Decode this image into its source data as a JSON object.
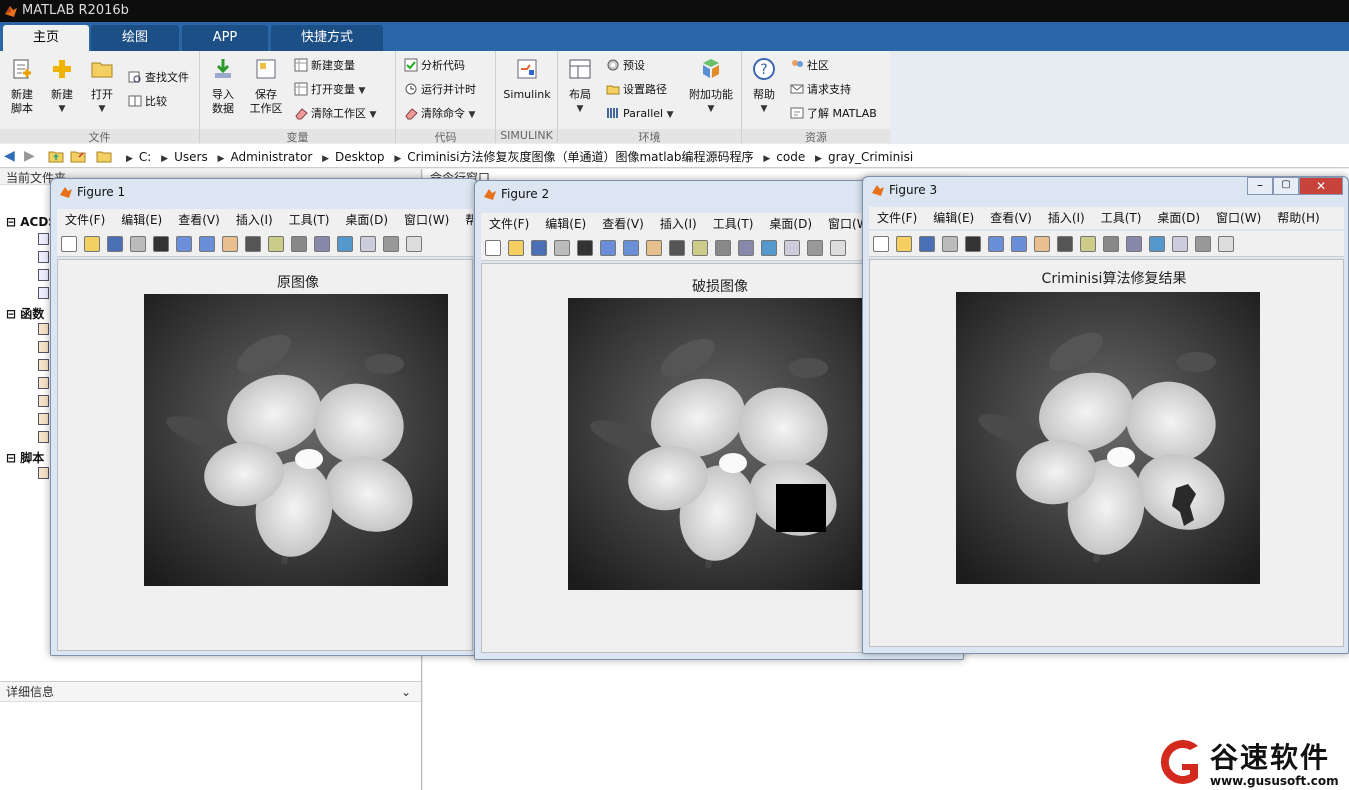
{
  "app": {
    "title": "MATLAB R2016b"
  },
  "ribbon": {
    "tabs": [
      "主页",
      "绘图",
      "APP",
      "快捷方式"
    ],
    "groups": {
      "file": {
        "label": "文件",
        "new_script": "新建\n脚本",
        "new": "新建",
        "open": "打开",
        "find_files": "查找文件",
        "compare": "比较"
      },
      "variable": {
        "label": "变量",
        "import": "导入\n数据",
        "save_ws": "保存\n工作区",
        "new_var": "新建变量",
        "open_var": "打开变量",
        "clear_ws": "清除工作区"
      },
      "code": {
        "label": "代码",
        "analyze": "分析代码",
        "run_time": "运行并计时",
        "clear_cmd": "清除命令"
      },
      "simulink": {
        "label": "SIMULINK",
        "simulink": "Simulink"
      },
      "env": {
        "label": "环境",
        "layout": "布局",
        "prefs": "预设",
        "set_path": "设置路径",
        "parallel": "Parallel",
        "addons": "附加功能"
      },
      "resources": {
        "label": "资源",
        "help": "帮助",
        "community": "社区",
        "support": "请求支持",
        "learn": "了解 MATLAB"
      }
    }
  },
  "address": {
    "crumbs": [
      "C:",
      "Users",
      "Administrator",
      "Desktop",
      "Criminisi方法修复灰度图像（单通道）图像matlab编程源码程序",
      "code",
      "gray_Criminisi"
    ]
  },
  "left_panel": {
    "header": "当前文件夹",
    "tree": {
      "acds": "ACDS",
      "functions": "函数",
      "scripts": "脚本"
    },
    "details": "详细信息"
  },
  "command_window": {
    "header": "命令行窗口"
  },
  "figures": [
    {
      "title": "Figure 1",
      "menus": [
        "文件(F)",
        "编辑(E)",
        "查看(V)",
        "插入(I)",
        "工具(T)",
        "桌面(D)",
        "窗口(W)",
        "帮助"
      ],
      "image_title": "原图像"
    },
    {
      "title": "Figure 2",
      "menus": [
        "文件(F)",
        "编辑(E)",
        "查看(V)",
        "插入(I)",
        "工具(T)",
        "桌面(D)",
        "窗口(W"
      ],
      "image_title": "破损图像"
    },
    {
      "title": "Figure 3",
      "menus": [
        "文件(F)",
        "编辑(E)",
        "查看(V)",
        "插入(I)",
        "工具(T)",
        "桌面(D)",
        "窗口(W)",
        "帮助(H)"
      ],
      "image_title": "Criminisi算法修复结果"
    }
  ],
  "watermark": {
    "name": "谷速软件",
    "url": "www.gususoft.com"
  },
  "colors": {
    "tab_bar": "#2b67a8",
    "brand_red": "#d42a1e"
  }
}
